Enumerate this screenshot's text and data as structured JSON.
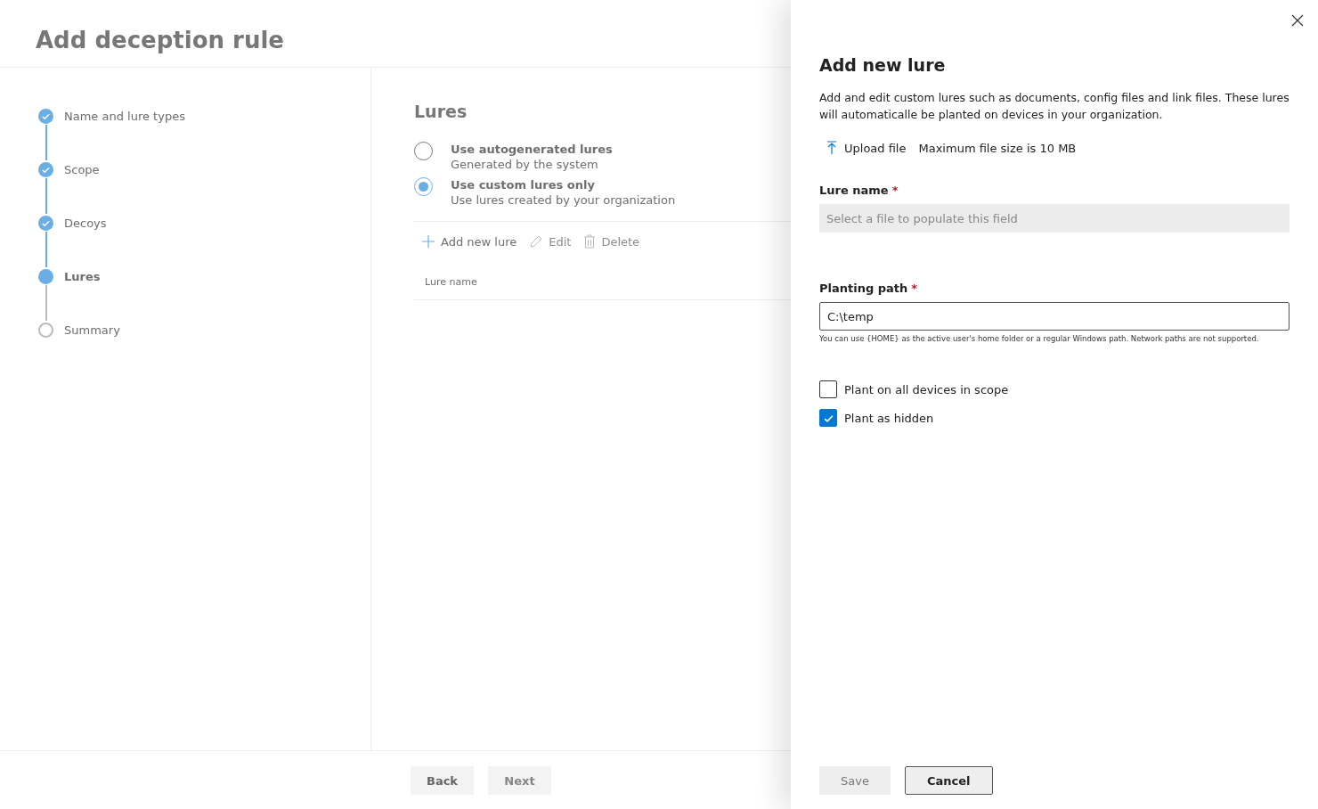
{
  "page": {
    "title": "Add deception rule"
  },
  "steps": [
    {
      "label": "Name and lure types",
      "completed": true,
      "selected": false
    },
    {
      "label": "Scope",
      "completed": true,
      "selected": false
    },
    {
      "label": "Decoys",
      "completed": true,
      "selected": false
    },
    {
      "label": "Lures",
      "completed": false,
      "selected": true
    },
    {
      "label": "Summary",
      "completed": false,
      "selected": false
    }
  ],
  "section": {
    "title": "Lures",
    "options": [
      {
        "label": "Use autogenerated lures",
        "description": "Generated by the system",
        "selected": false
      },
      {
        "label": "Use custom lures only",
        "description": "Use lures created by your organization",
        "selected": true
      }
    ],
    "toolbar": [
      {
        "kind": "add",
        "label": "Add new lure",
        "disabled": false
      },
      {
        "kind": "edit",
        "label": "Edit",
        "disabled": true
      },
      {
        "kind": "delete",
        "label": "Delete",
        "disabled": true
      }
    ],
    "table": {
      "columns": [
        "Lure name"
      ]
    }
  },
  "footer": {
    "buttons": [
      {
        "label": "Back",
        "disabled": false
      },
      {
        "label": "Next",
        "disabled": true
      }
    ]
  },
  "panel": {
    "title": "Add new lure",
    "description": "Add and edit custom lures such as documents, config files and link files. These lures will automaticalle be planted on devices in your organization.",
    "upload": {
      "label": "Upload file",
      "note": "Maximum file size is 10 MB"
    },
    "lure_name": {
      "label": "Lure name",
      "required": "*",
      "placeholder": "Select a file to populate this field",
      "disabled": true
    },
    "planting_path": {
      "label": "Planting path",
      "required": "*",
      "value": "C:\\temp",
      "hint": "You can use {HOME} as the active user's home folder or a regular Windows path. Network paths are not supported."
    },
    "checkboxes": [
      {
        "label": "Plant on all devices in scope",
        "checked": false
      },
      {
        "label": "Plant as hidden",
        "checked": true
      }
    ],
    "buttons": [
      {
        "kind": "primary",
        "label": "Save",
        "disabled": true
      },
      {
        "kind": "default",
        "label": "Cancel",
        "disabled": false
      }
    ]
  }
}
